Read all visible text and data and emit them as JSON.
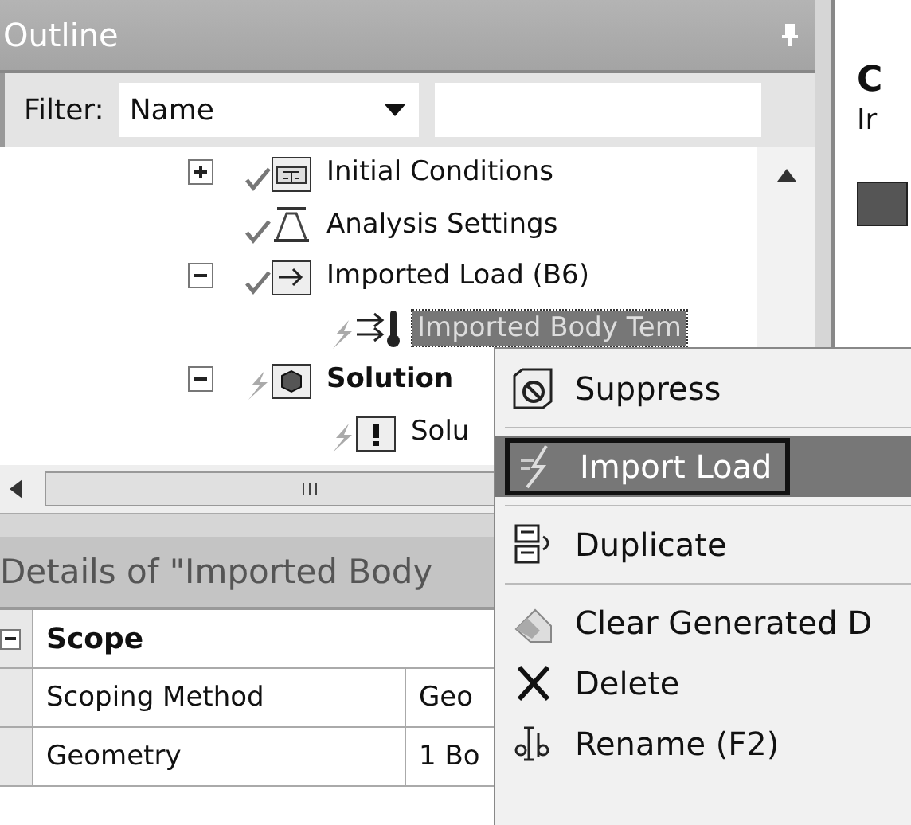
{
  "outline": {
    "title": "Outline",
    "filter_label": "Filter:",
    "filter_value": "Name",
    "items": [
      {
        "label": "Initial Conditions",
        "kind": "initial",
        "valid": true,
        "expanded": false,
        "selected": false,
        "active": false
      },
      {
        "label": "Analysis Settings",
        "kind": "analysis",
        "valid": true,
        "selected": false,
        "active": false
      },
      {
        "label": "Imported Load (B6)",
        "kind": "load",
        "valid": true,
        "expanded": true,
        "selected": false,
        "active": false,
        "children": [
          {
            "label": "Imported Body Tem",
            "kind": "temp",
            "valid": false,
            "selected": true,
            "active": false
          }
        ]
      },
      {
        "label": "Solution",
        "kind": "solution",
        "valid": false,
        "expanded": true,
        "selected": false,
        "active": true,
        "children": [
          {
            "label": "Solu",
            "kind": "info",
            "valid": false,
            "selected": false,
            "active": false
          }
        ]
      }
    ]
  },
  "details": {
    "title": "Details of \"Imported Body",
    "rows": [
      {
        "kind": "group",
        "label": "Scope",
        "expanded": true
      },
      {
        "kind": "property",
        "name": "Scoping Method",
        "value": "Geo"
      },
      {
        "kind": "property",
        "name": "Geometry",
        "value": "1 Bo"
      }
    ]
  },
  "side_panel": {
    "heading": "C",
    "text": "Ir"
  },
  "context_menu": [
    {
      "label": "Suppress",
      "kind": "suppress",
      "selected": false,
      "divider_after": true
    },
    {
      "label": "Import Load",
      "kind": "import",
      "selected": true,
      "divider_after": true
    },
    {
      "label": "Duplicate",
      "kind": "duplicate",
      "selected": false,
      "divider_after": true
    },
    {
      "label": "Clear Generated D",
      "kind": "clear",
      "selected": false,
      "divider_after": false
    },
    {
      "label": "Delete",
      "kind": "delete",
      "selected": false,
      "divider_after": false
    },
    {
      "label": "Rename (F2)",
      "kind": "rename",
      "selected": false,
      "divider_after": false
    }
  ]
}
